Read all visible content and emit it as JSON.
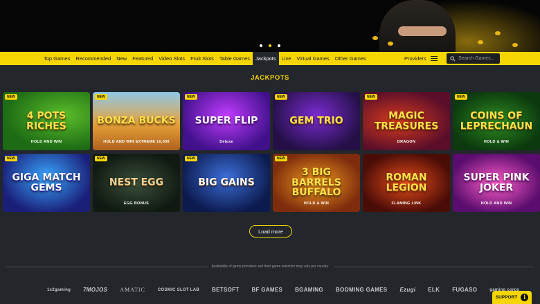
{
  "hero": {
    "carousel_slides": 3,
    "active_slide": 2
  },
  "nav": {
    "items": [
      {
        "label": "Top Games"
      },
      {
        "label": "Recommended"
      },
      {
        "label": "New"
      },
      {
        "label": "Featured"
      },
      {
        "label": "Video Slots"
      },
      {
        "label": "Fruit Slots"
      },
      {
        "label": "Table Games"
      },
      {
        "label": "Jackpots",
        "active": true
      },
      {
        "label": "Live"
      },
      {
        "label": "Virtual Games"
      },
      {
        "label": "Other Games"
      }
    ],
    "providers_label": "Providers",
    "search_placeholder": "Search Games..."
  },
  "section": {
    "title": "JACKPOTS"
  },
  "games": [
    {
      "badge": "NEW",
      "title": "4 POTS RICHES",
      "subtitle": "HOLD AND WIN"
    },
    {
      "badge": "NEW",
      "title": "BONZA BUCKS",
      "subtitle": "HOLD AND WIN EXTREME 10,000"
    },
    {
      "badge": "NEW",
      "title": "SUPER FLIP",
      "subtitle": "Deluxe"
    },
    {
      "badge": "NEW",
      "title": "GEM TRIO",
      "subtitle": ""
    },
    {
      "badge": "NEW",
      "title": "MAGIC TREASURES",
      "subtitle": "DRAGON"
    },
    {
      "badge": "NEW",
      "title": "COINS OF LEPRECHAUN",
      "subtitle": "HOLD & WIN"
    },
    {
      "badge": "NEW",
      "title": "GIGA MATCH GEMS",
      "subtitle": ""
    },
    {
      "badge": "NEW",
      "title": "NEST EGG",
      "subtitle": "EGG BONUS"
    },
    {
      "badge": "NEW",
      "title": "BIG GAINS",
      "subtitle": ""
    },
    {
      "badge": "NEW",
      "title": "3 BIG BARRELS BUFFALO",
      "subtitle": "HOLD & WIN"
    },
    {
      "badge": "",
      "title": "ROMAN LEGION",
      "subtitle": "FLAMING LINK"
    },
    {
      "badge": "",
      "title": "SUPER PINK JOKER",
      "subtitle": "HOLD AND WIN"
    }
  ],
  "load_more_label": "Load more",
  "footer": {
    "note": "Availability of game providers and their game selection may vary per country",
    "providers": [
      "1x2gaming",
      "7MOJOS",
      "AMATIC",
      "COSMIC SLOT LAB",
      "BETSOFT",
      "BF GAMES",
      "BGAMING",
      "BOOMING GAMES",
      "Ezugi",
      "ELK",
      "FUGASO",
      "gaming corps"
    ]
  },
  "support_label": "SUPPORT",
  "colors": {
    "accent": "#f5d600",
    "background": "#23262b"
  }
}
